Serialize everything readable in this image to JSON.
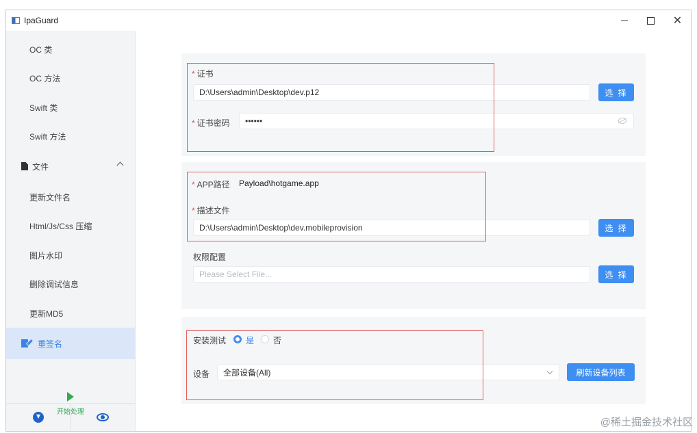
{
  "window": {
    "title": "IpaGuard",
    "controls": {
      "minimize": "minimize-icon",
      "maximize": "maximize-icon",
      "close": "✕"
    }
  },
  "sidebar": {
    "items": [
      {
        "label": "OC 类"
      },
      {
        "label": "OC 方法"
      },
      {
        "label": "Swift 类"
      },
      {
        "label": "Swift 方法"
      },
      {
        "label": "文件",
        "icon": "file-icon",
        "expanded": true
      },
      {
        "label": "更新文件名"
      },
      {
        "label": "Html/Js/Css 压缩"
      },
      {
        "label": "图片水印"
      },
      {
        "label": "删除调试信息"
      },
      {
        "label": "更新MD5"
      },
      {
        "label": "重签名",
        "icon": "sign-icon",
        "active": true
      }
    ],
    "start": {
      "label": "开始处理",
      "icon": "play-icon",
      "color": "#35a853"
    },
    "bottom": [
      {
        "icon": "download-icon"
      },
      {
        "icon": "eye-icon"
      }
    ]
  },
  "cert": {
    "label": "证书",
    "path": "D:\\Users\\admin\\Desktop\\dev.p12",
    "choose_label": "选 择",
    "password_label": "证书密码",
    "password_value": "••••••"
  },
  "app": {
    "path_label": "APP路径",
    "path_value": "Payload\\hotgame.app",
    "profile_label": "描述文件",
    "profile_value": "D:\\Users\\admin\\Desktop\\dev.mobileprovision",
    "choose_label": "选 择",
    "entitlements_label": "权限配置",
    "entitlements_placeholder": "Please Select File...",
    "entitlements_choose_label": "选 择"
  },
  "install": {
    "test_label": "安装测试",
    "yes_label": "是",
    "no_label": "否",
    "selected": "是",
    "device_label": "设备",
    "device_value": "全部设备(All)",
    "refresh_label": "刷新设备列表"
  },
  "colors": {
    "accent": "#3f8ef2",
    "required": "#e34b4b",
    "highlight_box": "#e05c5c"
  },
  "watermark": "@稀土掘金技术社区"
}
